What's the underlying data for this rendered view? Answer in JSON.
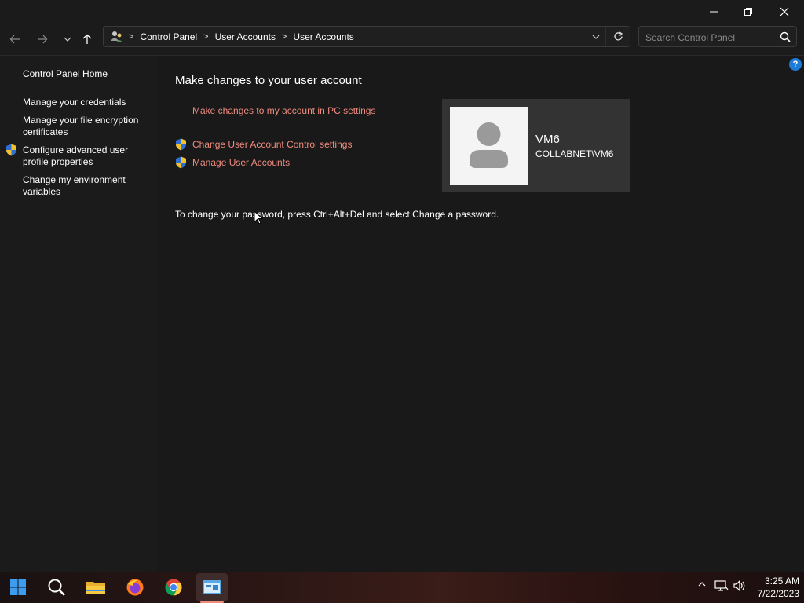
{
  "window": {
    "minimize_glyph": "—",
    "maximize_glyph": "❐",
    "close_glyph": "✕"
  },
  "nav": {
    "breadcrumbs": [
      "Control Panel",
      "User Accounts",
      "User Accounts"
    ],
    "search_placeholder": "Search Control Panel"
  },
  "sidebar": {
    "items": [
      {
        "label": "Control Panel Home",
        "shield": false
      },
      {
        "label": "Manage your credentials",
        "shield": false
      },
      {
        "label": "Manage your file encryption certificates",
        "shield": false
      },
      {
        "label": "Configure advanced user profile properties",
        "shield": true
      },
      {
        "label": "Change my environment variables",
        "shield": false
      }
    ]
  },
  "main": {
    "heading": "Make changes to your user account",
    "links": {
      "pc_settings": "Make changes to my account in PC settings",
      "uac": "Change User Account Control settings",
      "manage_accounts": "Manage User Accounts"
    },
    "password_note": "To change your password, press Ctrl+Alt+Del and select Change a password.",
    "account": {
      "name": "VM6",
      "domain": "COLLABNET\\VM6"
    },
    "help_glyph": "?"
  },
  "taskbar": {
    "apps": [
      "start-icon",
      "search-icon",
      "file-explorer-icon",
      "firefox-icon",
      "chrome-icon",
      "control-panel-icon"
    ],
    "time": "3:25 AM",
    "date": "7/22/2023"
  },
  "colors": {
    "link": "#f08b7e",
    "background": "#1b1b1b",
    "card": "#333333",
    "accent": "#1e7bd6"
  }
}
